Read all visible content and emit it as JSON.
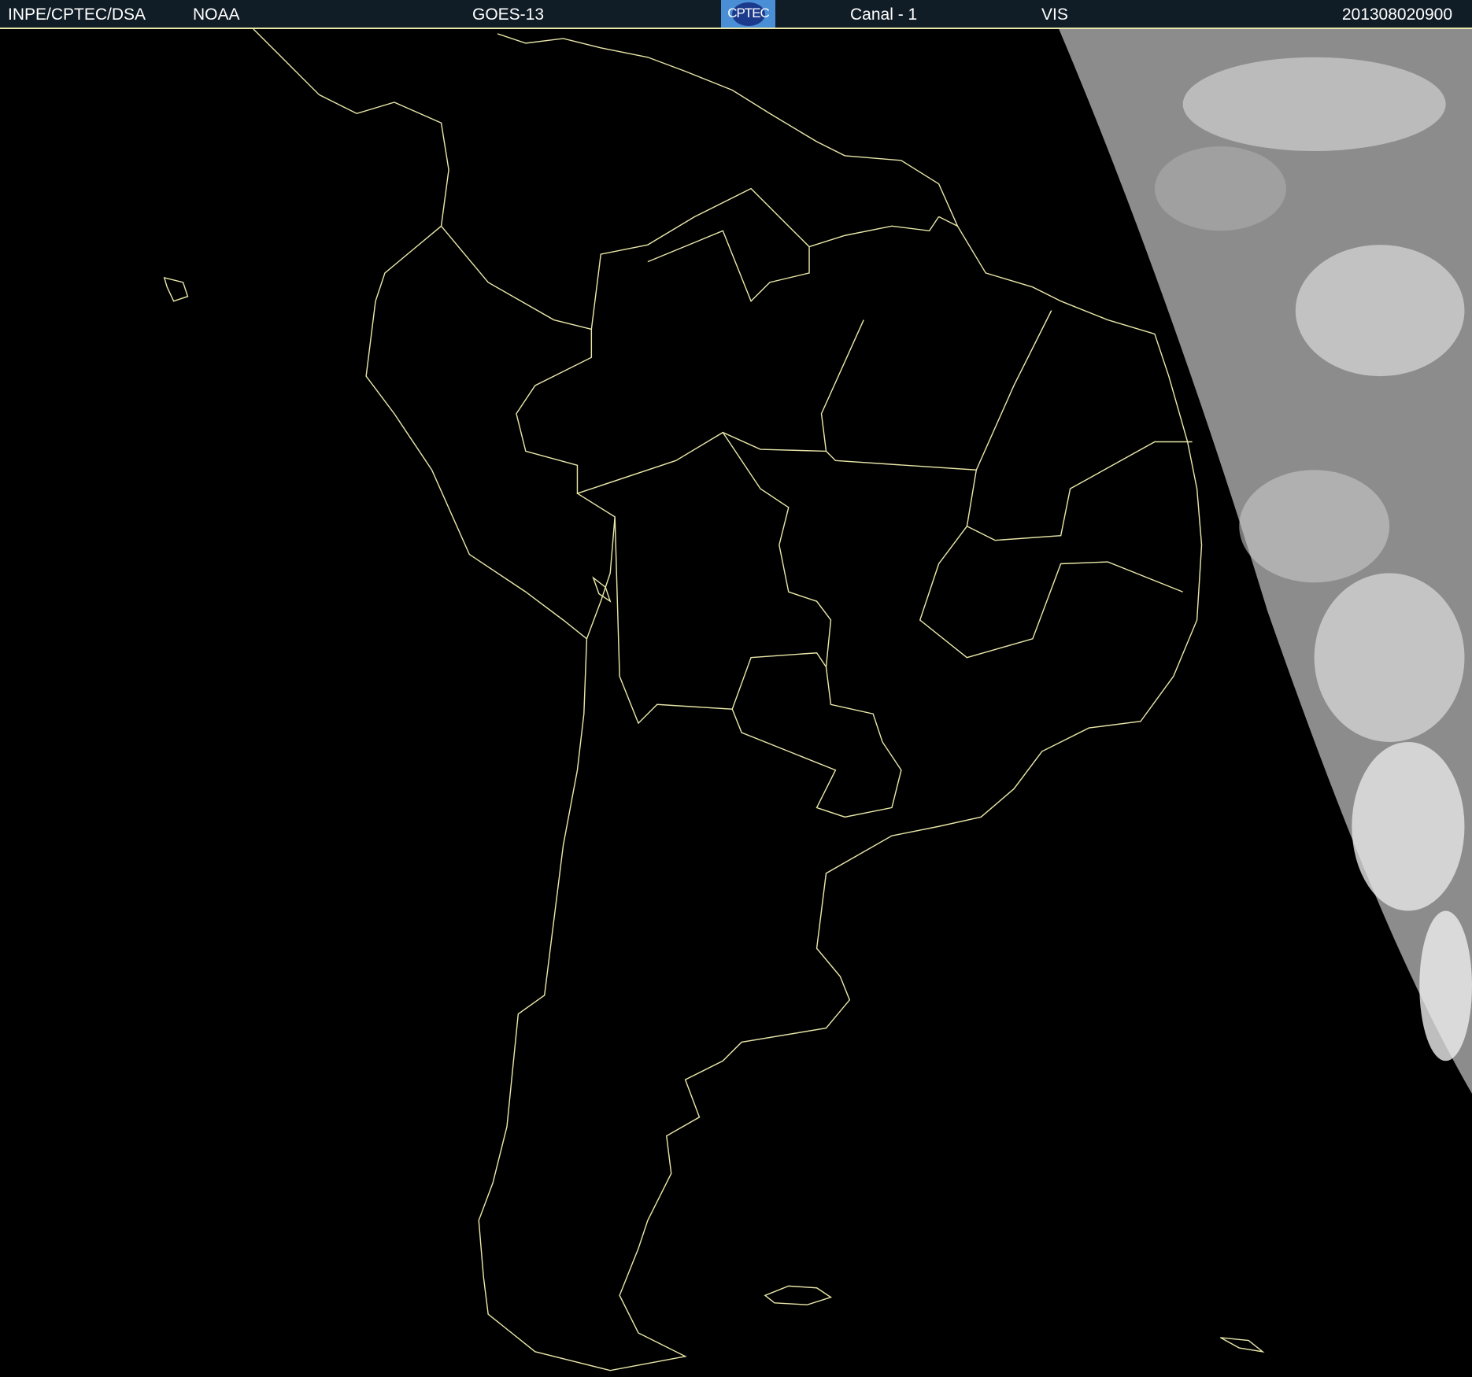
{
  "header": {
    "institution": "INPE/CPTEC/DSA",
    "agency": "NOAA",
    "satellite": "GOES-13",
    "logo_text": "CPTEC",
    "channel": "Canal - 1",
    "band": "VIS",
    "timestamp": "201308020900"
  },
  "colors": {
    "header_bg": "#111d26",
    "coastline": "#e8e6a8",
    "map_bg": "#000000",
    "cloud": "#8c8c8c"
  }
}
